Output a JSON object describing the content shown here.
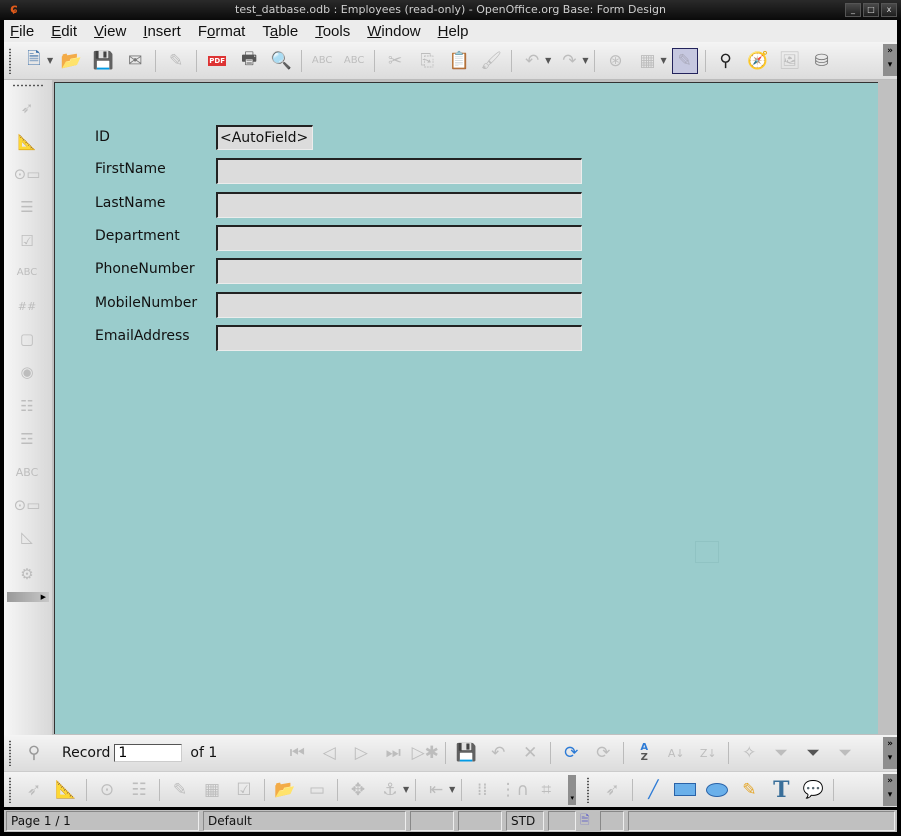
{
  "window": {
    "title": "test_datbase.odb : Employees (read-only) - OpenOffice.org Base: Form Design",
    "app_icon": "openoffice-gull-icon",
    "controls": {
      "minimize": "_",
      "maximize": "□",
      "close": "x"
    }
  },
  "menubar": {
    "items": [
      {
        "label": "File",
        "mnemonic": "F",
        "rest": "ile"
      },
      {
        "label": "Edit",
        "mnemonic": "E",
        "rest": "dit"
      },
      {
        "label": "View",
        "mnemonic": "V",
        "rest": "iew"
      },
      {
        "label": "Insert",
        "mnemonic": "I",
        "rest": "nsert"
      },
      {
        "label": "Format",
        "pre": "F",
        "mnemonic": "o",
        "rest": "rmat"
      },
      {
        "label": "Table",
        "pre": "T",
        "mnemonic": "a",
        "rest": "ble"
      },
      {
        "label": "Tools",
        "mnemonic": "T",
        "rest": "ools"
      },
      {
        "label": "Window",
        "mnemonic": "W",
        "rest": "indow"
      },
      {
        "label": "Help",
        "mnemonic": "H",
        "rest": "elp"
      }
    ]
  },
  "standard_toolbar": {
    "icons": [
      "new-document-icon",
      "open-folder-icon",
      "save-icon",
      "email-icon",
      "edit-file-icon",
      "export-pdf-icon",
      "print-icon",
      "print-preview-icon",
      "spellcheck-icon",
      "autospellcheck-icon",
      "cut-icon",
      "copy-icon",
      "paste-icon",
      "format-paintbrush-icon",
      "undo-icon",
      "redo-icon",
      "navigator-icon",
      "table-icon",
      "design-mode-icon",
      "find-icon",
      "form-navigator-icon",
      "gallery-icon",
      "data-sources-icon"
    ],
    "pdf_label": "PDF",
    "overflow": "»"
  },
  "form_controls_sidebar": {
    "icons": [
      "select-icon",
      "design-mode-icon",
      "form-control-icon",
      "form-design-icon",
      "checkbox-icon",
      "text-box-icon",
      "formatted-field-icon",
      "push-button-icon",
      "option-button-icon",
      "list-box-icon",
      "combo-box-icon",
      "label-field-icon",
      "more-controls-icon",
      "form-design-toolbar-icon",
      "wizards-icon"
    ],
    "text_box_label": "ABC",
    "label_field_label": "ABC",
    "formatted_field_label": "##"
  },
  "form": {
    "fields": [
      {
        "label": "ID",
        "value": "<AutoField>"
      },
      {
        "label": "FirstName",
        "value": ""
      },
      {
        "label": "LastName",
        "value": ""
      },
      {
        "label": "Department",
        "value": ""
      },
      {
        "label": "PhoneNumber",
        "value": ""
      },
      {
        "label": "MobileNumber",
        "value": ""
      },
      {
        "label": "EmailAddress",
        "value": ""
      }
    ]
  },
  "navigation_bar": {
    "record_label": "Record",
    "record_value": "1",
    "of_label": "of 1",
    "sort_az_top": "A",
    "sort_az_bottom": "Z"
  },
  "form_design_toolbar": {
    "icons": [
      "select-icon",
      "design-mode-icon",
      "control-icon",
      "form-icon",
      "form-properties-icon",
      "tab-order-icon",
      "add-field-icon",
      "activation-order-icon",
      "open-design-mode-icon",
      "automatic-control-focus-icon",
      "position-size-icon",
      "anchor-icon",
      "alignment-icon",
      "grid-icon",
      "snap-to-grid-icon",
      "guides-icon"
    ],
    "drawing_icons": [
      "select-icon",
      "line-icon",
      "rectangle-icon",
      "ellipse-icon",
      "freeform-line-icon",
      "text-icon",
      "callout-icon"
    ],
    "text_tool_glyph": "T"
  },
  "statusbar": {
    "page": "Page 1 / 1",
    "style": "Default",
    "mode": "STD"
  },
  "colors": {
    "canvas": "#9acccc",
    "field_bg": "#dcdcdc",
    "active_tool": "#c6c8e0"
  }
}
